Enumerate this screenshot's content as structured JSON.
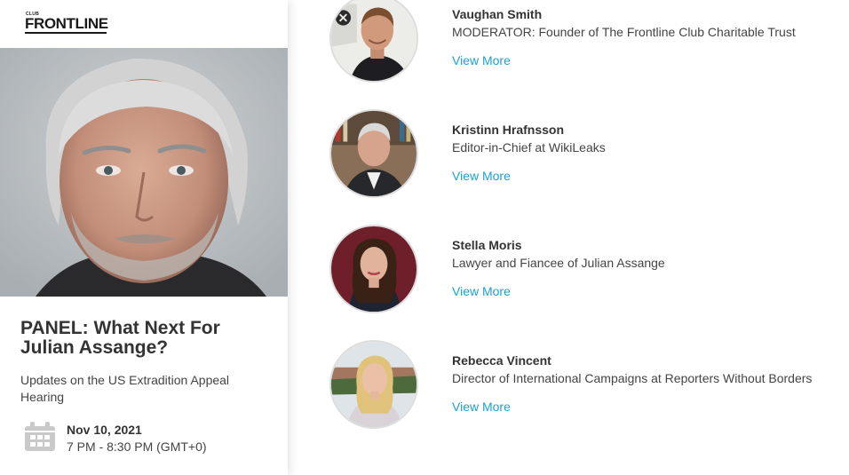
{
  "brand": {
    "small": "CLUB",
    "name": "FRONTLINE"
  },
  "event": {
    "title": "PANEL: What Next For Julian Assange?",
    "subtitle": "Updates on the US Extradition Appeal Hearing",
    "date": "Nov 10, 2021",
    "time": "7 PM - 8:30 PM (GMT+0)",
    "icon": "calendar-icon"
  },
  "speakers": [
    {
      "name": "Vaughan Smith",
      "role": "MODERATOR: Founder of The Frontline Club Charitable Trust",
      "link": "View More"
    },
    {
      "name": "Kristinn Hrafnsson",
      "role": "Editor-in-Chief at WikiLeaks",
      "link": "View More"
    },
    {
      "name": "Stella Moris",
      "role": "Lawyer and Fiancee of Julian Assange",
      "link": "View More"
    },
    {
      "name": "Rebecca Vincent",
      "role": "Director of International Campaigns at Reporters Without Borders",
      "link": "View More"
    }
  ],
  "colors": {
    "link": "#1aa1d6",
    "text": "#333333",
    "icon": "#c9c9c9"
  }
}
